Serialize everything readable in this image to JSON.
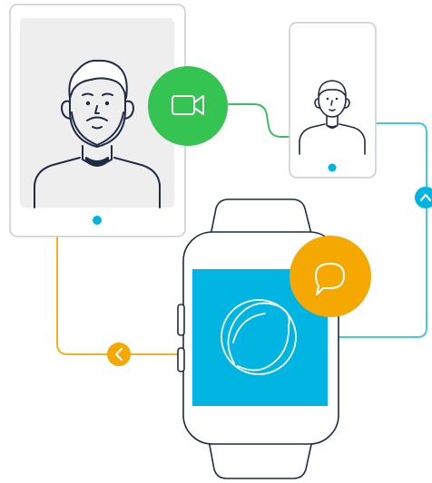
{
  "colors": {
    "background": "#ffffff",
    "outline": "#1e2b45",
    "tablet_screen": "#eeeeee",
    "accent_blue": "#00b5e2",
    "accent_green": "#35c451",
    "accent_orange": "#f5a800",
    "line_green": "#3dbe5b",
    "line_blue": "#46c7e6",
    "line_orange": "#f2b01e"
  },
  "icons": {
    "video_call": "video-camera-icon",
    "chat": "chat-bubble-icon",
    "nav_up": "chevron-up-icon",
    "nav_left": "chevron-left-icon",
    "watch_app": "app-logo-icon"
  },
  "devices": {
    "tablet": {
      "kind": "tablet",
      "person": "bearded man"
    },
    "phone": {
      "kind": "phone",
      "person": "man"
    },
    "watch": {
      "kind": "smartwatch",
      "screen_color": "#00b5e2"
    }
  }
}
